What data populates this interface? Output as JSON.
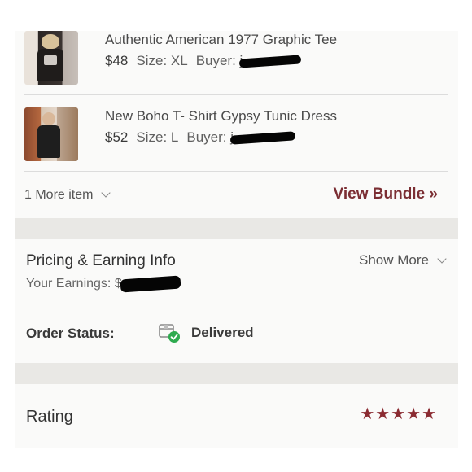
{
  "items": [
    {
      "title": "Authentic American 1977 Graphic Tee",
      "price": "$48",
      "size_label": "Size: XL",
      "buyer_label": "Buyer: j"
    },
    {
      "title": "New Boho T- Shirt Gypsy Tunic Dress",
      "price": "$52",
      "size_label": "Size: L",
      "buyer_label": "Buyer: j"
    }
  ],
  "bundle": {
    "more_items": "1 More item",
    "view_bundle": "View Bundle »"
  },
  "pricing": {
    "title": "Pricing & Earning Info",
    "show_more": "Show More",
    "earnings_label": "Your Earnings: $"
  },
  "order_status": {
    "label": "Order Status:",
    "value": "Delivered",
    "icon": "delivered-box-check-icon"
  },
  "rating": {
    "label": "Rating",
    "stars": "★★★★★",
    "value": 5,
    "max": 5
  },
  "colors": {
    "accent": "#7b2e33",
    "success": "#2eaa4f",
    "divider": "#dcdcdc",
    "section_gap": "#e9e8e5"
  }
}
